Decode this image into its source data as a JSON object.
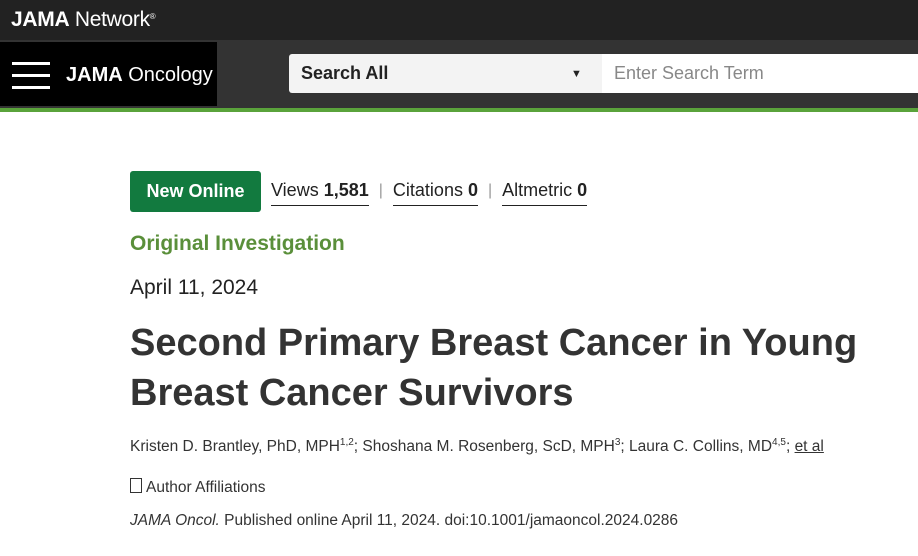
{
  "network_logo": {
    "bold": "JAMA",
    "light": "Network",
    "tm": "®"
  },
  "journal": {
    "bold": "JAMA",
    "name": "Oncology"
  },
  "search": {
    "scope": "Search All",
    "placeholder": "Enter Search Term"
  },
  "article": {
    "badge": "New Online",
    "metrics": [
      {
        "label": "Views",
        "value": "1,581"
      },
      {
        "label": "Citations",
        "value": "0"
      },
      {
        "label": "Altmetric",
        "value": "0"
      }
    ],
    "category": "Original Investigation",
    "date": "April 11, 2024",
    "title": "Second Primary Breast Cancer in Young Breast Cancer Survivors",
    "authors": [
      {
        "name": "Kristen D. Brantley, PhD, MPH",
        "sup": "1,2",
        "sep": "; "
      },
      {
        "name": "Shoshana M. Rosenberg, ScD, MPH",
        "sup": "3",
        "sep": "; "
      },
      {
        "name": "Laura C. Collins, MD",
        "sup": "4,5",
        "sep": "; "
      }
    ],
    "et_al": "et al",
    "affiliations_label": "Author Affiliations",
    "citation": {
      "journal_abbrev": "JAMA Oncol.",
      "text": " Published online April 11, 2024. doi:10.1001/jamaoncol.2024.0286"
    }
  },
  "colors": {
    "badge": "#127a3f",
    "category": "#5a8f3a",
    "accent_rule": "#5aa33b"
  },
  "icons": {
    "menu": "hamburger-icon",
    "dropdown": "caret-down-icon",
    "affiliations": "expand-box-icon"
  }
}
